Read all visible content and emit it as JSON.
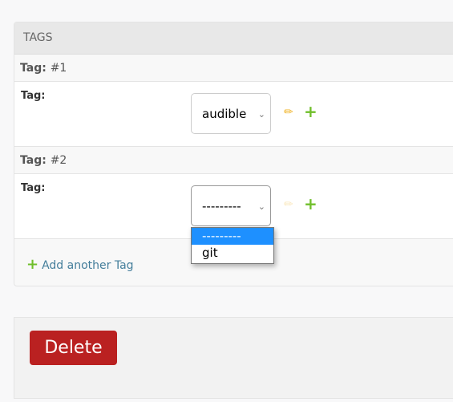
{
  "module": {
    "title": "TAGS"
  },
  "inlines": [
    {
      "header_label": "Tag:",
      "header_num": "#1",
      "field_label": "Tag:",
      "value": "audible",
      "edit_enabled": true
    },
    {
      "header_label": "Tag:",
      "header_num": "#2",
      "field_label": "Tag:",
      "value": "---------",
      "edit_enabled": false
    }
  ],
  "dropdown": {
    "options": [
      "---------",
      "git"
    ],
    "highlighted": "---------"
  },
  "add_another": "Add another Tag",
  "delete_label": "Delete",
  "colors": {
    "delete": "#ba2121",
    "add": "#70bf2b",
    "edit": "#f0b429",
    "highlight": "#1e90ff"
  }
}
